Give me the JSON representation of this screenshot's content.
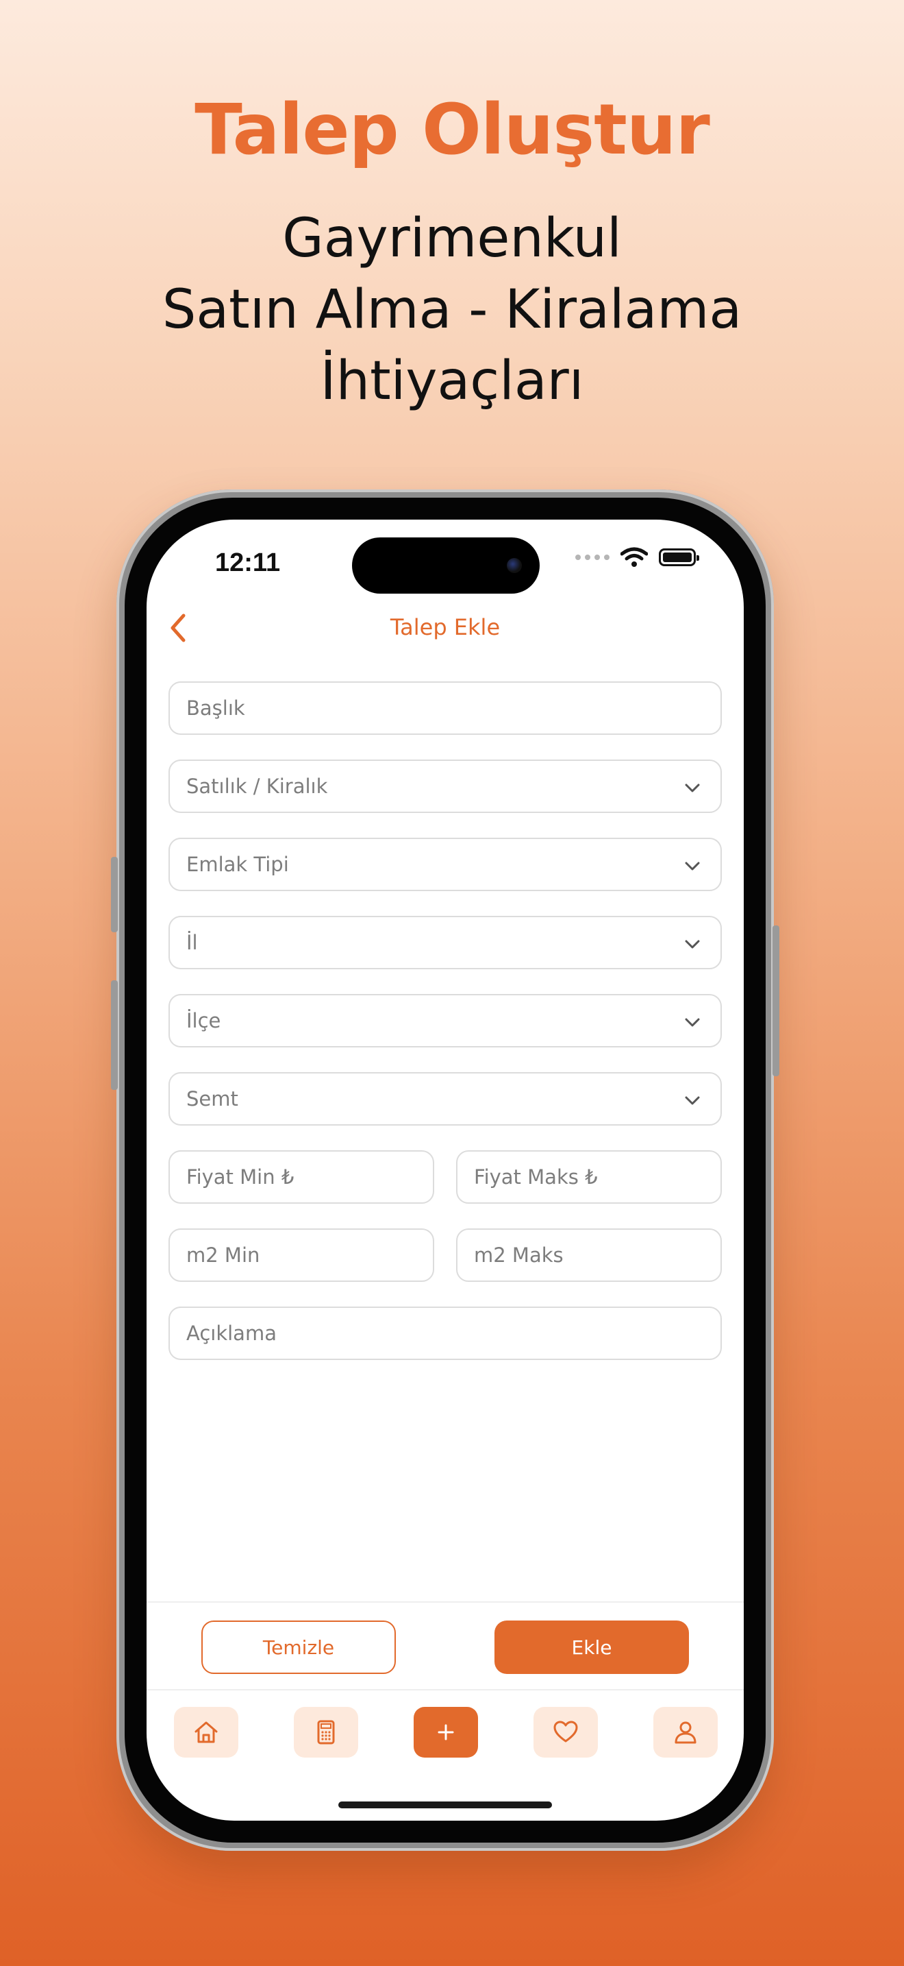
{
  "promo": {
    "headline": "Talep Oluştur",
    "subline": [
      "Gayrimenkul",
      "Satın Alma - Kiralama",
      "İhtiyaçları"
    ]
  },
  "status_bar": {
    "time": "12:11"
  },
  "nav": {
    "title": "Talep Ekle"
  },
  "form": {
    "title_placeholder": "Başlık",
    "selects": {
      "listing_type": "Satılık / Kiralık",
      "property_type": "Emlak Tipi",
      "city": "İl",
      "district": "İlçe",
      "neighborhood": "Semt"
    },
    "price_min_placeholder": "Fiyat Min ₺",
    "price_max_placeholder": "Fiyat Maks ₺",
    "area_min_placeholder": "m2 Min",
    "area_max_placeholder": "m2 Maks",
    "description_placeholder": "Açıklama"
  },
  "actions": {
    "clear_label": "Temizle",
    "add_label": "Ekle"
  },
  "tab_bar": {
    "items": [
      {
        "icon": "home-icon"
      },
      {
        "icon": "calculator-icon"
      },
      {
        "icon": "plus-icon",
        "active": true
      },
      {
        "icon": "heart-icon"
      },
      {
        "icon": "user-icon"
      }
    ]
  },
  "colors": {
    "accent": "#e26a2c",
    "headline": "#e86d32",
    "tab_bg": "#fde9dc"
  }
}
